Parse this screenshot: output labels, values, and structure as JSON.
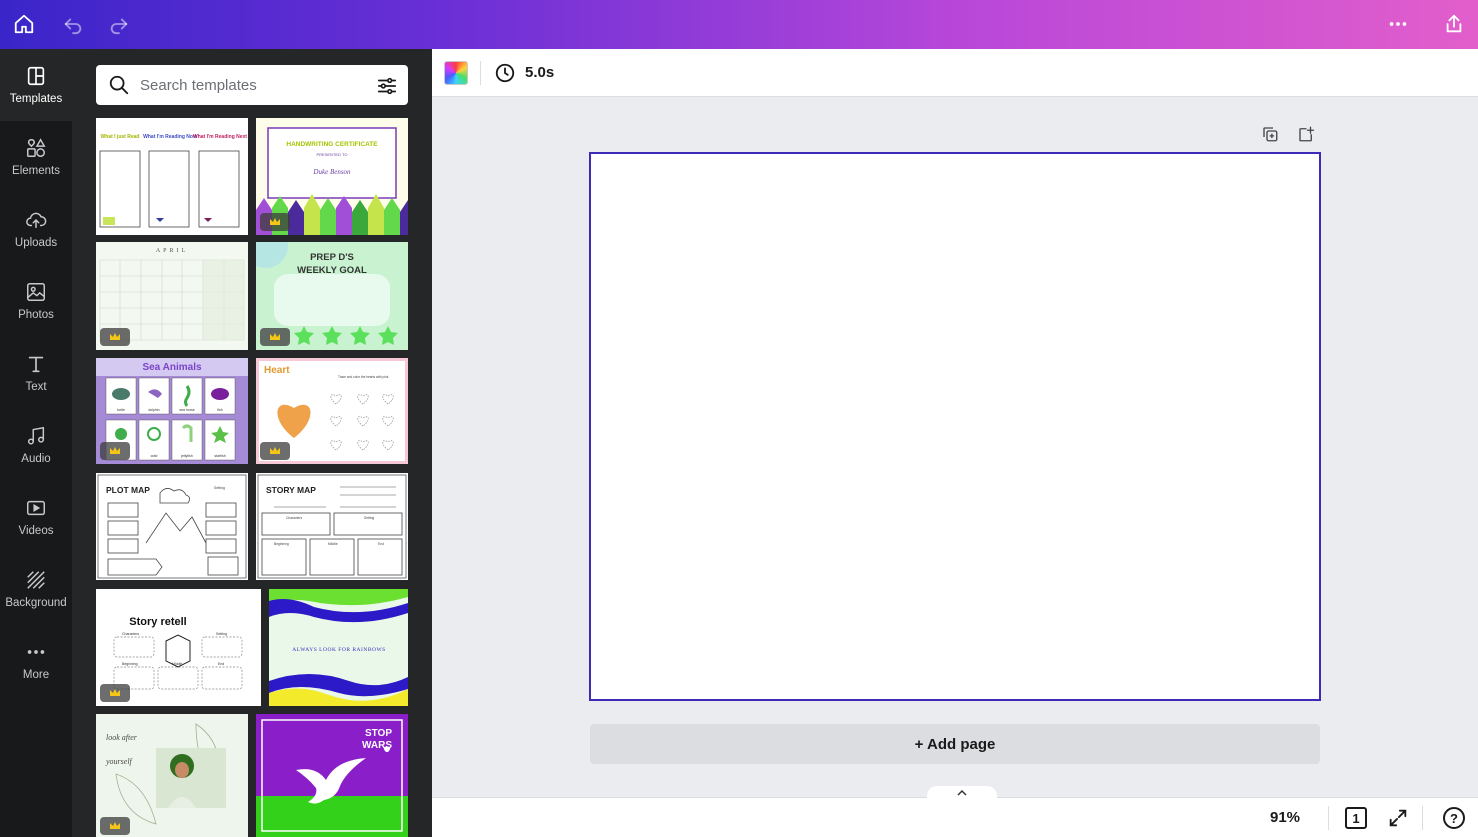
{
  "colors": {
    "accent": "#3d2ab8",
    "rail_bg": "#18191b",
    "panel_bg": "#252627"
  },
  "topbar": {
    "home_icon": "home-icon",
    "undo_icon": "undo-icon",
    "redo_icon": "redo-icon",
    "more_icon": "more-horizontal-icon",
    "share_icon": "share-icon"
  },
  "sidebar": {
    "items": [
      {
        "label": "Templates",
        "icon": "templates-icon"
      },
      {
        "label": "Elements",
        "icon": "elements-icon"
      },
      {
        "label": "Uploads",
        "icon": "upload-cloud-icon"
      },
      {
        "label": "Photos",
        "icon": "photo-icon"
      },
      {
        "label": "Text",
        "icon": "text-icon"
      },
      {
        "label": "Audio",
        "icon": "music-note-icon"
      },
      {
        "label": "Videos",
        "icon": "video-icon"
      },
      {
        "label": "Background",
        "icon": "background-icon"
      },
      {
        "label": "More",
        "icon": "more-dots-icon"
      }
    ]
  },
  "search": {
    "placeholder": "Search templates"
  },
  "templates": [
    {
      "lines": [
        "What I just Read",
        "What I'm Reading Now",
        "What I'm Reading Next"
      ],
      "premium": false
    },
    {
      "lines": [
        "HANDWRITING CERTIFICATE",
        "PRESENTED TO",
        "Duke Benson"
      ],
      "premium": true
    },
    {
      "lines": [
        "APRIL"
      ],
      "premium": true
    },
    {
      "lines": [
        "PREP D'S",
        "WEEKLY GOAL"
      ],
      "premium": true
    },
    {
      "lines": [
        "Sea Animals",
        "turtle",
        "dolphin",
        "sea horse",
        "fish",
        "crab",
        "jellyfish",
        "starfish"
      ],
      "premium": true
    },
    {
      "lines": [
        "Heart",
        "Trace and color the hearts with pink."
      ],
      "premium": true
    },
    {
      "lines": [
        "PLOT MAP",
        "Setting"
      ],
      "premium": false
    },
    {
      "lines": [
        "STORY MAP",
        "Characters",
        "Setting",
        "Beginning",
        "Middle",
        "End"
      ],
      "premium": false
    },
    {
      "lines": [
        "Story retell",
        "Characters",
        "Setting",
        "Beginning",
        "Middle",
        "End"
      ],
      "premium": true
    },
    {
      "lines": [
        "ALWAYS LOOK FOR RAINBOWS"
      ],
      "premium": false
    },
    {
      "lines": [
        "look after",
        "yourself"
      ],
      "premium": true
    },
    {
      "lines": [
        "STOP",
        "WARS"
      ],
      "premium": false
    }
  ],
  "editor": {
    "duration": "5.0s",
    "add_page": "+ Add page"
  },
  "footer": {
    "zoom": "91%",
    "page_count": "1",
    "help": "?"
  }
}
